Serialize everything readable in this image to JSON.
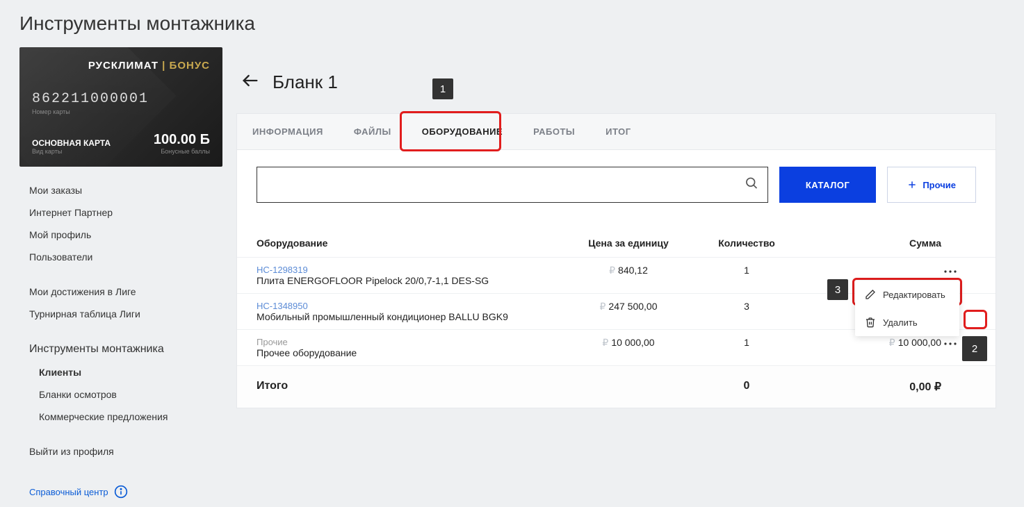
{
  "pageTitle": "Инструменты монтажника",
  "card": {
    "brand": "РУСКЛИМАТ",
    "brandSuffix": " | БОНУС",
    "number": "862211000001",
    "numberLabel": "Номер карты",
    "type": "ОСНОВНАЯ КАРТА",
    "typeSub": "Вид карты",
    "balance": "100.00 Б",
    "balanceSub": "Бонусные баллы"
  },
  "nav": {
    "items1": [
      "Мои заказы",
      "Интернет Партнер",
      "Мой профиль",
      "Пользователи"
    ],
    "items2": [
      "Мои достижения в Лиге",
      "Турнирная таблица Лиги"
    ],
    "groupTitle": "Инструменты монтажника",
    "subItems": [
      "Клиенты",
      "Бланки осмотров",
      "Коммерческие предложения"
    ],
    "activeSub": 0,
    "logout": "Выйти из профиля",
    "help": "Справочный центр"
  },
  "main": {
    "title": "Бланк 1",
    "tabs": [
      "ИНФОРМАЦИЯ",
      "ФАЙЛЫ",
      "ОБОРУДОВАНИЕ",
      "РАБОТЫ",
      "ИТОГ"
    ],
    "activeTab": 2,
    "searchValue": "",
    "catalogBtn": "КАТАЛОГ",
    "otherBtn": "Прочие",
    "columns": {
      "equip": "Оборудование",
      "price": "Цена за единицу",
      "qty": "Количество",
      "sum": "Сумма"
    },
    "rows": [
      {
        "sku": "НС-1298319",
        "desc": "Плита ENERGOFLOOR Pipelock 20/0,7-1,1 DES-SG",
        "price": "840,12",
        "qty": "1",
        "sum": ""
      },
      {
        "sku": "НС-1348950",
        "desc": "Мобильный промышленный кондиционер BALLU BGK9",
        "price": "247 500,00",
        "qty": "3",
        "sum": ""
      },
      {
        "sku": "Прочие",
        "desc": "Прочее оборудование",
        "price": "10 000,00",
        "qty": "1",
        "sum": "10 000,00",
        "other": true
      }
    ],
    "footer": {
      "label": "Итого",
      "qty": "0",
      "sum": "0,00 ₽"
    },
    "context": {
      "edit": "Редактировать",
      "delete": "Удалить"
    }
  },
  "annotations": {
    "n1": "1",
    "n2": "2",
    "n3": "3"
  }
}
